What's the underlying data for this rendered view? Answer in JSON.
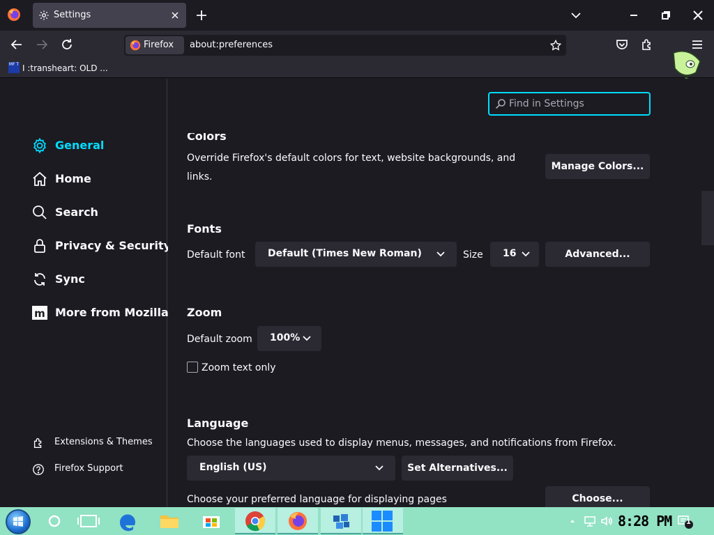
{
  "tab": {
    "title": "Settings"
  },
  "urlbar": {
    "identity": "Firefox",
    "url": "about:preferences"
  },
  "bookmarks": [
    {
      "icon_text": "MF T",
      "label": "I :transheart: OLD ..."
    }
  ],
  "search": {
    "placeholder": "Find in Settings"
  },
  "sidebar": {
    "categories": [
      {
        "label": "General",
        "icon": "gear-icon",
        "selected": true
      },
      {
        "label": "Home",
        "icon": "home-icon"
      },
      {
        "label": "Search",
        "icon": "search-icon"
      },
      {
        "label": "Privacy & Security",
        "icon": "lock-icon"
      },
      {
        "label": "Sync",
        "icon": "sync-icon"
      },
      {
        "label": "More from Mozilla",
        "icon": "mozilla-icon"
      }
    ],
    "footer": [
      {
        "label": "Extensions & Themes",
        "icon": "puzzle-icon"
      },
      {
        "label": "Firefox Support",
        "icon": "help-icon"
      }
    ]
  },
  "colors_section": {
    "heading": "Colors",
    "description": "Override Firefox's default colors for text, website backgrounds, and links.",
    "button": "Manage Colors..."
  },
  "fonts_section": {
    "heading": "Fonts",
    "default_font_label": "Default font",
    "default_font_value": "Default (Times New Roman)",
    "size_label": "Size",
    "size_value": "16",
    "advanced_button": "Advanced..."
  },
  "zoom_section": {
    "heading": "Zoom",
    "default_zoom_label": "Default zoom",
    "default_zoom_value": "100%",
    "zoom_text_only_label": "Zoom text only",
    "zoom_text_only_checked": false
  },
  "language_section": {
    "heading": "Language",
    "description": "Choose the languages used to display menus, messages, and notifications from Firefox.",
    "language_value": "English (US)",
    "alternatives_button": "Set Alternatives...",
    "page_lang_description": "Choose your preferred language for displaying pages",
    "choose_button": "Choose..."
  },
  "taskbar": {
    "clock": "8:28 PM",
    "notification_count": "1"
  },
  "colors": {
    "accent": "#00ddff",
    "background": "#1c1b22",
    "toolbar": "#2b2a33",
    "taskbar": "#92e2c4"
  }
}
